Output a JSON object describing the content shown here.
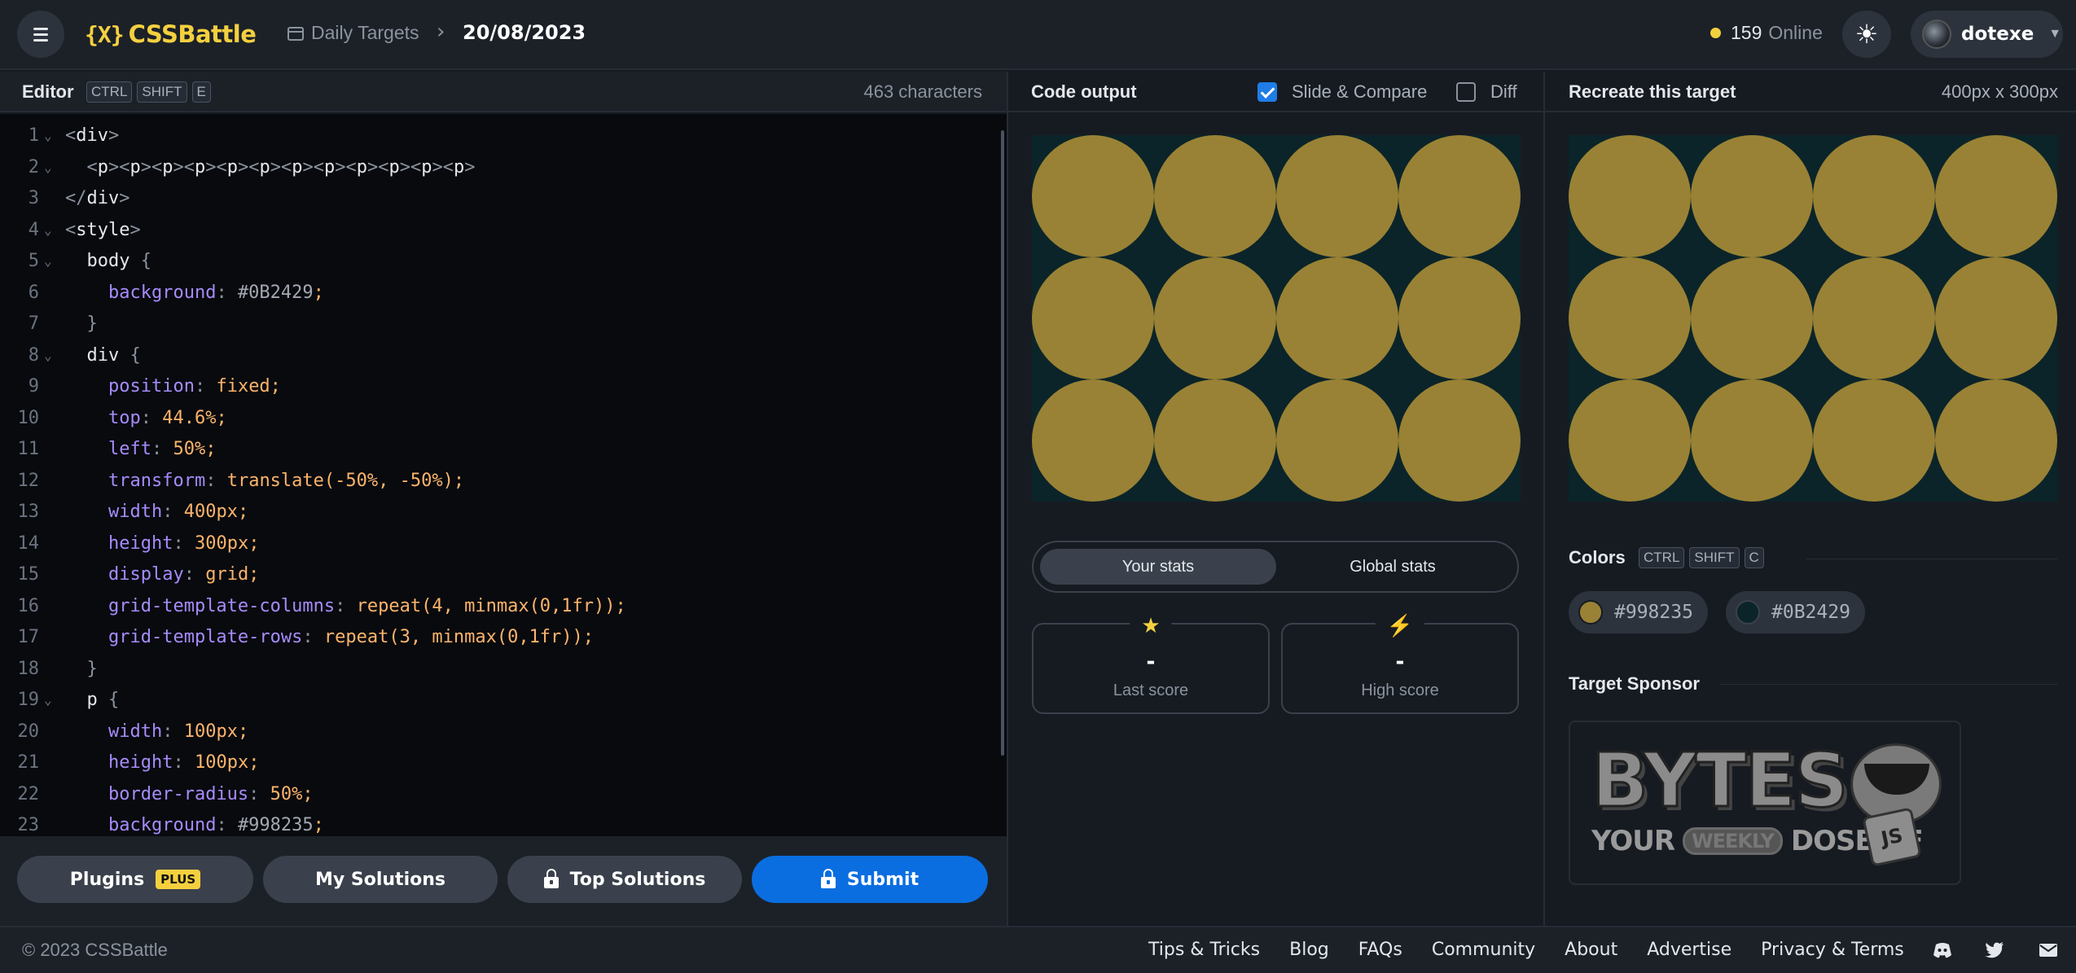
{
  "header": {
    "logo_mark": "{X}",
    "logo_text": "CSSBattle",
    "breadcrumb_section": "Daily Targets",
    "breadcrumb_sep": "›",
    "breadcrumb_date": "20/08/2023",
    "online_count": "159",
    "online_label": "Online",
    "user_name": "dotexe",
    "accent_color": "#f4d03f"
  },
  "editor": {
    "title": "Editor",
    "shortcut_keys": [
      "CTRL",
      "SHIFT",
      "E"
    ],
    "char_count": "463 characters",
    "lines": [
      {
        "n": "1",
        "fold": true,
        "html": "<span class=\"t-punc\">&lt;</span><span class=\"t-tag\">div</span><span class=\"t-punc\">&gt;</span>"
      },
      {
        "n": "2",
        "fold": true,
        "html": "  <span class=\"t-punc\">&lt;</span><span class=\"t-tag\">p</span><span class=\"t-punc\">&gt;&lt;</span><span class=\"t-tag\">p</span><span class=\"t-punc\">&gt;&lt;</span><span class=\"t-tag\">p</span><span class=\"t-punc\">&gt;&lt;</span><span class=\"t-tag\">p</span><span class=\"t-punc\">&gt;&lt;</span><span class=\"t-tag\">p</span><span class=\"t-punc\">&gt;&lt;</span><span class=\"t-tag\">p</span><span class=\"t-punc\">&gt;&lt;</span><span class=\"t-tag\">p</span><span class=\"t-punc\">&gt;&lt;</span><span class=\"t-tag\">p</span><span class=\"t-punc\">&gt;&lt;</span><span class=\"t-tag\">p</span><span class=\"t-punc\">&gt;&lt;</span><span class=\"t-tag\">p</span><span class=\"t-punc\">&gt;&lt;</span><span class=\"t-tag\">p</span><span class=\"t-punc\">&gt;&lt;</span><span class=\"t-tag\">p</span><span class=\"t-punc\">&gt;</span>"
      },
      {
        "n": "3",
        "fold": false,
        "html": "<span class=\"t-punc\">&lt;/</span><span class=\"t-tag\">div</span><span class=\"t-punc\">&gt;</span>"
      },
      {
        "n": "4",
        "fold": true,
        "html": "<span class=\"t-punc\">&lt;</span><span class=\"t-tag\">style</span><span class=\"t-punc\">&gt;</span>"
      },
      {
        "n": "5",
        "fold": true,
        "html": "  <span class=\"t-tag\">body</span> <span class=\"t-punc\">{</span>"
      },
      {
        "n": "6",
        "fold": false,
        "html": "    <span class=\"t-prop\">background</span><span class=\"t-punc\">:</span> <span class=\"t-str\">#0B2429</span><span class=\"t-val\">;</span>"
      },
      {
        "n": "7",
        "fold": false,
        "html": "  <span class=\"t-punc\">}</span>"
      },
      {
        "n": "8",
        "fold": true,
        "html": "  <span class=\"t-tag\">div</span> <span class=\"t-punc\">{</span>"
      },
      {
        "n": "9",
        "fold": false,
        "html": "    <span class=\"t-prop\">position</span><span class=\"t-punc\">:</span> <span class=\"t-val\">fixed;</span>"
      },
      {
        "n": "10",
        "fold": false,
        "html": "    <span class=\"t-prop\">top</span><span class=\"t-punc\">:</span> <span class=\"t-val\">44.6%;</span>"
      },
      {
        "n": "11",
        "fold": false,
        "html": "    <span class=\"t-prop\">left</span><span class=\"t-punc\">:</span> <span class=\"t-val\">50%;</span>"
      },
      {
        "n": "12",
        "fold": false,
        "html": "    <span class=\"t-prop\">transform</span><span class=\"t-punc\">:</span> <span class=\"t-val\">translate(-50%, -50%);</span>"
      },
      {
        "n": "13",
        "fold": false,
        "html": "    <span class=\"t-prop\">width</span><span class=\"t-punc\">:</span> <span class=\"t-val\">400px;</span>"
      },
      {
        "n": "14",
        "fold": false,
        "html": "    <span class=\"t-prop\">height</span><span class=\"t-punc\">:</span> <span class=\"t-val\">300px;</span>"
      },
      {
        "n": "15",
        "fold": false,
        "html": "    <span class=\"t-prop\">display</span><span class=\"t-punc\">:</span> <span class=\"t-val\">grid;</span>"
      },
      {
        "n": "16",
        "fold": false,
        "html": "    <span class=\"t-prop\">grid-template-columns</span><span class=\"t-punc\">:</span> <span class=\"t-val\">repeat(4, minmax(0,1fr));</span>"
      },
      {
        "n": "17",
        "fold": false,
        "html": "    <span class=\"t-prop\">grid-template-rows</span><span class=\"t-punc\">:</span> <span class=\"t-val\">repeat(3, minmax(0,1fr));</span>"
      },
      {
        "n": "18",
        "fold": false,
        "html": "  <span class=\"t-punc\">}</span>"
      },
      {
        "n": "19",
        "fold": true,
        "html": "  <span class=\"t-tag\">p</span> <span class=\"t-punc\">{</span>"
      },
      {
        "n": "20",
        "fold": false,
        "html": "    <span class=\"t-prop\">width</span><span class=\"t-punc\">:</span> <span class=\"t-val\">100px;</span>"
      },
      {
        "n": "21",
        "fold": false,
        "html": "    <span class=\"t-prop\">height</span><span class=\"t-punc\">:</span> <span class=\"t-val\">100px;</span>"
      },
      {
        "n": "22",
        "fold": false,
        "html": "    <span class=\"t-prop\">border-radius</span><span class=\"t-punc\">:</span> <span class=\"t-val\">50%;</span>"
      },
      {
        "n": "23",
        "fold": false,
        "html": "    <span class=\"t-prop\">background</span><span class=\"t-punc\">:</span> <span class=\"t-str\">#998235</span><span class=\"t-val\">;</span>"
      }
    ]
  },
  "editor_footer": {
    "plugins_label": "Plugins",
    "plugins_badge": "PLUS",
    "my_solutions_label": "My Solutions",
    "top_solutions_label": "Top Solutions",
    "submit_label": "Submit"
  },
  "output": {
    "title": "Code output",
    "slide_compare_label": "Slide & Compare",
    "slide_compare_checked": true,
    "diff_label": "Diff",
    "diff_checked": false,
    "circle_color": "#998235",
    "bg_color": "#0B2429",
    "grid_cols": 4,
    "grid_rows": 3
  },
  "stats": {
    "tab_your": "Your stats",
    "tab_global": "Global stats",
    "last_score_value": "-",
    "last_score_label": "Last score",
    "high_score_value": "-",
    "high_score_label": "High score",
    "star_icon": "★",
    "bolt_icon": "⚡"
  },
  "target": {
    "title": "Recreate this target",
    "size_label": "400px x 300px",
    "colors_title": "Colors",
    "colors_keys": [
      "CTRL",
      "SHIFT",
      "C"
    ],
    "swatches": [
      {
        "hex": "#998235"
      },
      {
        "hex": "#0B2429"
      }
    ],
    "sponsor_title": "Target Sponsor",
    "sponsor_word": "BYTES",
    "sponsor_your": "YOUR",
    "sponsor_weekly": "WEEKLY",
    "sponsor_dose": "DOSE OF",
    "sponsor_js": "JS"
  },
  "footer": {
    "copyright": "© 2023 CSSBattle",
    "links": [
      "Tips & Tricks",
      "Blog",
      "FAQs",
      "Community",
      "About",
      "Advertise",
      "Privacy & Terms"
    ]
  }
}
